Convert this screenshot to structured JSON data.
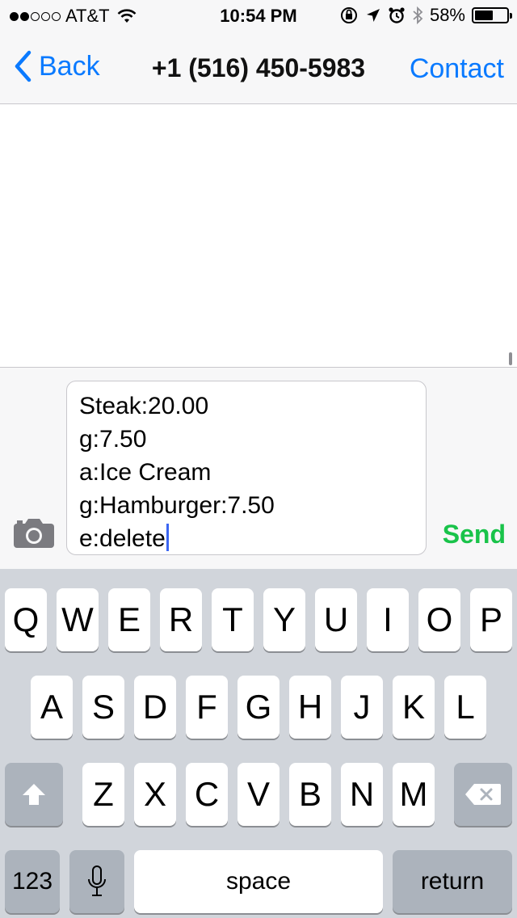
{
  "status_bar": {
    "carrier": "AT&T",
    "time": "10:54 PM",
    "battery": "58%",
    "battery_level": 0.58,
    "signal_bars_filled": 2,
    "signal_bars_total": 5
  },
  "navbar": {
    "back_label": "Back",
    "title": "+1 (516) 450-5983",
    "contact_label": "Contact"
  },
  "compose": {
    "lines": [
      "Steak:20.00",
      "g:7.50",
      "a:Ice Cream",
      "g:Hamburger:7.50",
      "e:delete"
    ],
    "send_label": "Send"
  },
  "keyboard": {
    "row1": [
      "Q",
      "W",
      "E",
      "R",
      "T",
      "Y",
      "U",
      "I",
      "O",
      "P"
    ],
    "row2": [
      "A",
      "S",
      "D",
      "F",
      "G",
      "H",
      "J",
      "K",
      "L"
    ],
    "row3": [
      "Z",
      "X",
      "C",
      "V",
      "B",
      "N",
      "M"
    ],
    "numbers_label": "123",
    "space_label": "space",
    "return_label": "return"
  },
  "colors": {
    "accent": "#0a7aff",
    "send": "#19c34a",
    "cursor": "#3b66f2"
  }
}
